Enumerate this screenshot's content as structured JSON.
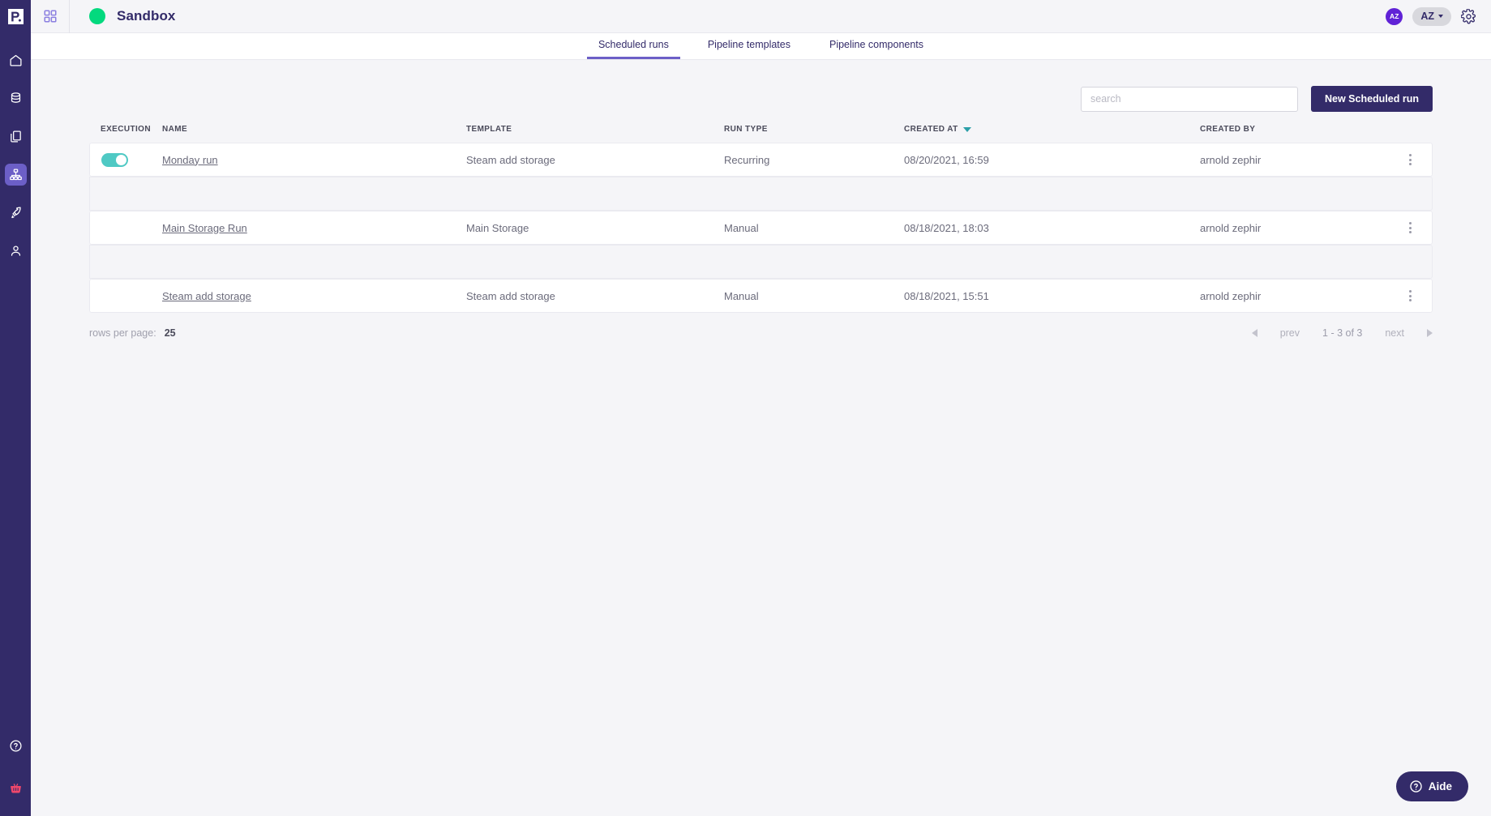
{
  "sidebar": {
    "logo": "paperspace-logo-icon",
    "items": [
      {
        "name": "home",
        "icon": "home-icon",
        "active": false
      },
      {
        "name": "data",
        "icon": "database-icon",
        "active": false
      },
      {
        "name": "documents",
        "icon": "documents-icon",
        "active": false
      },
      {
        "name": "pipelines",
        "icon": "sitemap-icon",
        "active": true
      },
      {
        "name": "deploy",
        "icon": "rocket-icon",
        "active": false
      },
      {
        "name": "account",
        "icon": "person-icon",
        "active": false
      }
    ],
    "bottom_items": [
      {
        "name": "help",
        "icon": "question-circle-icon"
      },
      {
        "name": "store",
        "icon": "basket-icon"
      }
    ]
  },
  "topbar": {
    "grid_icon": "grid-apps-icon",
    "status_dot_color": "#03d97e",
    "title": "Sandbox",
    "avatar_initials": "AZ",
    "user_menu_label": "AZ",
    "settings_icon": "gear-icon"
  },
  "tabs": [
    {
      "label": "Scheduled runs",
      "active": true
    },
    {
      "label": "Pipeline templates",
      "active": false
    },
    {
      "label": "Pipeline components",
      "active": false
    }
  ],
  "toolbar": {
    "search_placeholder": "search",
    "search_value": "",
    "new_run_label": "New Scheduled run"
  },
  "table": {
    "columns": [
      {
        "key": "execution",
        "label": "EXECUTION",
        "sorted": false
      },
      {
        "key": "name",
        "label": "NAME",
        "sorted": false
      },
      {
        "key": "template",
        "label": "TEMPLATE",
        "sorted": false
      },
      {
        "key": "run_type",
        "label": "RUN TYPE",
        "sorted": false
      },
      {
        "key": "created_at",
        "label": "CREATED AT",
        "sorted": true,
        "sort_dir": "desc"
      },
      {
        "key": "created_by",
        "label": "CREATED BY",
        "sorted": false
      }
    ],
    "rows": [
      {
        "execution_toggle": true,
        "name": "Monday run",
        "template": "Steam add storage",
        "run_type": "Recurring",
        "created_at": "08/20/2021, 16:59",
        "created_by": "arnold zephir",
        "menu_icon": "kebab-menu-icon"
      },
      {
        "execution_toggle": null,
        "name": "Main Storage Run",
        "template": "Main Storage",
        "run_type": "Manual",
        "created_at": "08/18/2021, 18:03",
        "created_by": "arnold zephir",
        "menu_icon": "kebab-menu-icon"
      },
      {
        "execution_toggle": null,
        "name": "Steam add storage",
        "template": "Steam add storage",
        "run_type": "Manual",
        "created_at": "08/18/2021, 15:51",
        "created_by": "arnold zephir",
        "menu_icon": "kebab-menu-icon"
      }
    ]
  },
  "pagination": {
    "rows_per_page_label": "rows per page:",
    "rows_per_page_value": "25",
    "prev_label": "prev",
    "range_label": "1 - 3 of 3",
    "next_label": "next"
  },
  "help_widget": {
    "label": "Aide",
    "icon": "question-circle-icon"
  },
  "colors": {
    "brand_navy": "#332b69",
    "accent_purple": "#6c5fc7",
    "toggle_teal": "#4fc9c4",
    "sort_teal": "#2b9fa8",
    "status_green": "#03d97e",
    "avatar_purple": "#6022d6",
    "basket_pink": "#f0486b"
  }
}
